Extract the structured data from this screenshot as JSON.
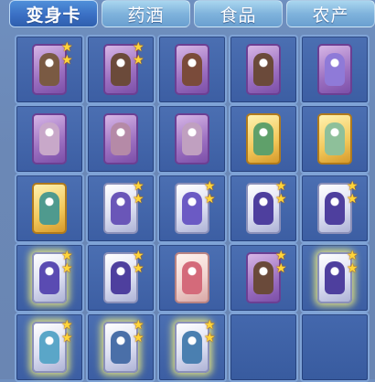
{
  "tabs": [
    {
      "label": "变身卡",
      "active": true
    },
    {
      "label": "药酒",
      "active": false
    },
    {
      "label": "食品",
      "active": false
    },
    {
      "label": "农产",
      "active": false
    }
  ],
  "slots": [
    {
      "card": "purple",
      "figure": "#7a5a43",
      "stars": 2
    },
    {
      "card": "purple",
      "figure": "#6b4a3a",
      "stars": 2
    },
    {
      "card": "purple",
      "figure": "#7a4b3a",
      "stars": 0
    },
    {
      "card": "purple",
      "figure": "#6b4a3a",
      "stars": 0
    },
    {
      "card": "purple",
      "figure": "#8f7ad8",
      "stars": 0
    },
    {
      "card": "purple",
      "figure": "#c8a8c9",
      "stars": 0
    },
    {
      "card": "purple",
      "figure": "#b58aa7",
      "stars": 0
    },
    {
      "card": "purple",
      "figure": "#c0a0c0",
      "stars": 0
    },
    {
      "card": "gold",
      "figure": "#5fa06a",
      "stars": 0
    },
    {
      "card": "gold",
      "figure": "#8ec09a",
      "stars": 0
    },
    {
      "card": "gold",
      "figure": "#4f9a8e",
      "stars": 0
    },
    {
      "card": "silver",
      "figure": "#6a56b8",
      "stars": 2
    },
    {
      "card": "silver",
      "figure": "#6b5ac4",
      "stars": 2
    },
    {
      "card": "silver",
      "figure": "#4e3f9e",
      "stars": 2
    },
    {
      "card": "silver",
      "figure": "#4e3f9e",
      "stars": 2
    },
    {
      "card": "silver",
      "figure": "#5a4bb2",
      "stars": 2,
      "glow": true
    },
    {
      "card": "silver",
      "figure": "#4e3f9e",
      "stars": 2
    },
    {
      "card": "pink",
      "figure": "#d46a7a",
      "stars": 0
    },
    {
      "card": "purple",
      "figure": "#6a4a3a",
      "stars": 2
    },
    {
      "card": "silver",
      "figure": "#4e3f9e",
      "stars": 2,
      "glow": true
    },
    {
      "card": "silver",
      "figure": "#5aa6c8",
      "stars": 2,
      "glow": true
    },
    {
      "card": "silver",
      "figure": "#4a6fa8",
      "stars": 2,
      "glow": true
    },
    {
      "card": "silver",
      "figure": "#4a7fb0",
      "stars": 2,
      "glow": true
    },
    {
      "card": null
    },
    {
      "card": null
    }
  ],
  "icons": {
    "star": "star-icon"
  }
}
